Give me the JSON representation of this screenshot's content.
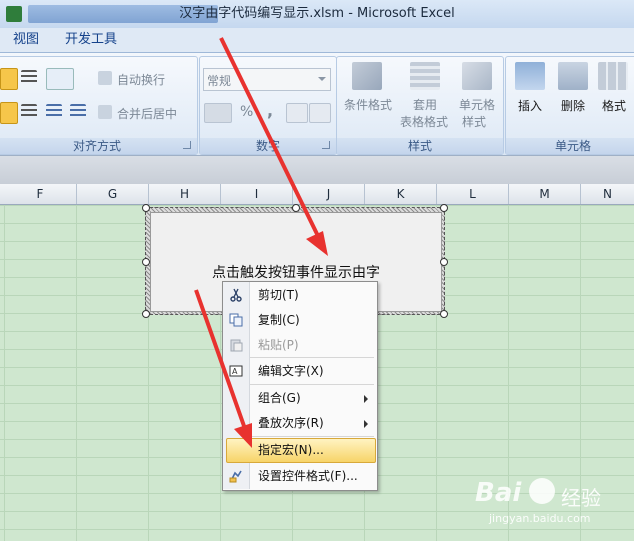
{
  "window": {
    "title": "汉字由字代码编写显示.xlsm - Microsoft Excel"
  },
  "menu_tabs": [
    "视图",
    "开发工具"
  ],
  "ribbon": {
    "alignment": {
      "wrap_text": "自动换行",
      "merge_center": "合并后居中",
      "group_label": "对齐方式"
    },
    "number": {
      "format_value": "常规",
      "percent": "%",
      "comma": ",",
      "group_label": "数字"
    },
    "styles": {
      "conditional_format": "条件格式",
      "table_format_1": "套用",
      "table_format_2": "表格格式",
      "cell_style_1": "单元格",
      "cell_style_2": "样式",
      "group_label": "样式"
    },
    "cells": {
      "insert": "插入",
      "delete": "删除",
      "format": "格式",
      "group_label": "单元格"
    }
  },
  "columns": [
    "F",
    "G",
    "H",
    "I",
    "J",
    "K",
    "L",
    "M",
    "N"
  ],
  "form_button": {
    "label": "点击触发按钮事件显示由字"
  },
  "context_menu": {
    "items": [
      {
        "label": "剪切(T)",
        "icon": "scissors-icon",
        "enabled": true
      },
      {
        "label": "复制(C)",
        "icon": "copy-icon",
        "enabled": true
      },
      {
        "label": "粘贴(P)",
        "icon": "paste-icon",
        "enabled": false
      },
      {
        "label": "编辑文字(X)",
        "icon": "edit-text-icon",
        "enabled": true
      },
      {
        "label": "组合(G)",
        "icon": "",
        "enabled": true,
        "submenu": true
      },
      {
        "label": "叠放次序(R)",
        "icon": "",
        "enabled": true,
        "submenu": true
      },
      {
        "label": "指定宏(N)...",
        "icon": "",
        "enabled": true,
        "highlighted": true
      },
      {
        "label": "设置控件格式(F)...",
        "icon": "format-control-icon",
        "enabled": true
      }
    ]
  },
  "watermark": {
    "brand": "Bai",
    "brand2": "经验",
    "url": "jingyan.baidu.com"
  },
  "colors": {
    "arrow": "#e8322f",
    "grid_bg": "#cfe7cf",
    "highlight": "#f7d469"
  }
}
